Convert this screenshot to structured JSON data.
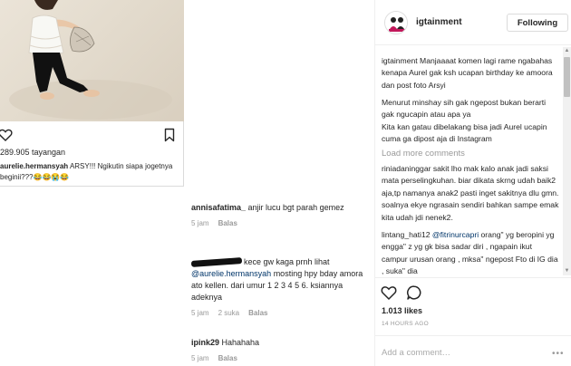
{
  "left_post": {
    "views": "289.905 tayangan",
    "caption_user": "aurelie.hermansyah",
    "caption_text": " ARSY!!! Ngikutin siapa jogetnya",
    "caption_text_2": "beginii???😂😂😭😂"
  },
  "mid_comments": [
    {
      "user": "annisafatima_",
      "text": " anjir lucu bgt parah gemez",
      "time": "5 jam",
      "likes": "",
      "reply": "Balas"
    },
    {
      "user": "",
      "text_a": "kece gw kaga prnh lihat",
      "mention": "@aurelie.hermansyah",
      "text_b": " mosting hpy bday amora ato kellen. dari umur 1 2 3 4 5 6. ksiannya adeknya",
      "time": "5 jam",
      "likes": "2 suka",
      "reply": "Balas"
    },
    {
      "user": "ipink29",
      "text": " Hahahaha",
      "time": "5 jam",
      "likes": "",
      "reply": "Balas"
    }
  ],
  "right_panel": {
    "account": "igtainment",
    "follow_label": "Following",
    "caption": "igtainment Manjaaaat komen lagi rame ngabahas kenapa Aurel gak ksh ucapan birthday ke amoora dan post foto Arsyi",
    "caption_2": "Menurut minshay sih gak ngepost bukan berarti gak ngucapin atau apa ya",
    "caption_3": "Kita kan gatau dibelakang bisa jadi Aurel ucapin cuma ga dipost aja di Instagram",
    "load_more": "Load more comments",
    "comment_1": "riniadaninggar sakit lho mak kalo anak jadi saksi mata perselingkuhan. biar dikata skrng udah baik2 aja,tp namanya anak2 pasti inget sakitnya dlu gmn. soalnya ekye ngrasain sendiri bahkan sampe emak kita udah jdi nenek2.",
    "comment_2_a": "lintang_hati12 ",
    "comment_2_mention": "@fitrinurcapri",
    "comment_2_b": " orang\" yg beropini yg engga\" z yg gk bisa sadar diri , ngapain ikut campur urusan orang , mksa\" ngepost Fto di IG dia , suka\" dia",
    "likes": "1.013 likes",
    "time": "14 HOURS AGO",
    "add_comment_placeholder": "Add a comment…",
    "more_label": "•••"
  },
  "colors": {
    "text": "#262626",
    "muted": "#999999",
    "mention": "#003569",
    "border": "#efefef"
  },
  "icons": [
    "heart-icon",
    "comment-icon",
    "bookmark-icon",
    "scroll-up-icon",
    "scroll-down-icon"
  ]
}
